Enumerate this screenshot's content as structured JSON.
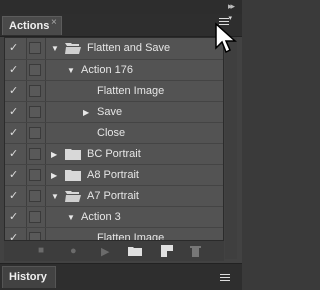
{
  "panel": {
    "tab_label": "Actions",
    "tab_close": "×",
    "collapse_glyph": "▸▸",
    "menu_icon": "panel-menu-icon"
  },
  "rows": [
    {
      "check": "✓",
      "expanded": true,
      "type": "set",
      "label": "Flatten and Save"
    },
    {
      "check": "✓",
      "expanded": true,
      "type": "action",
      "label": "Action 176"
    },
    {
      "check": "✓",
      "expanded": null,
      "type": "command",
      "label": "Flatten Image"
    },
    {
      "check": "✓",
      "expanded": false,
      "type": "command",
      "label": "Save"
    },
    {
      "check": "✓",
      "expanded": null,
      "type": "command",
      "label": "Close"
    },
    {
      "check": "✓",
      "expanded": false,
      "type": "set",
      "label": "BC Portrait"
    },
    {
      "check": "✓",
      "expanded": false,
      "type": "set",
      "label": "A8 Portrait"
    },
    {
      "check": "✓",
      "expanded": true,
      "type": "set",
      "label": "A7 Portrait"
    },
    {
      "check": "✓",
      "expanded": true,
      "type": "action",
      "label": "Action 3"
    },
    {
      "check": "✓",
      "expanded": null,
      "type": "command",
      "label": "Flatten Image"
    }
  ],
  "toolbar": {
    "stop": "stop-icon",
    "record": "record-icon",
    "play": "play-icon",
    "new_set": "new-set-icon",
    "new_action": "new-action-icon",
    "delete": "trash-icon"
  },
  "history": {
    "tab_label": "History"
  }
}
